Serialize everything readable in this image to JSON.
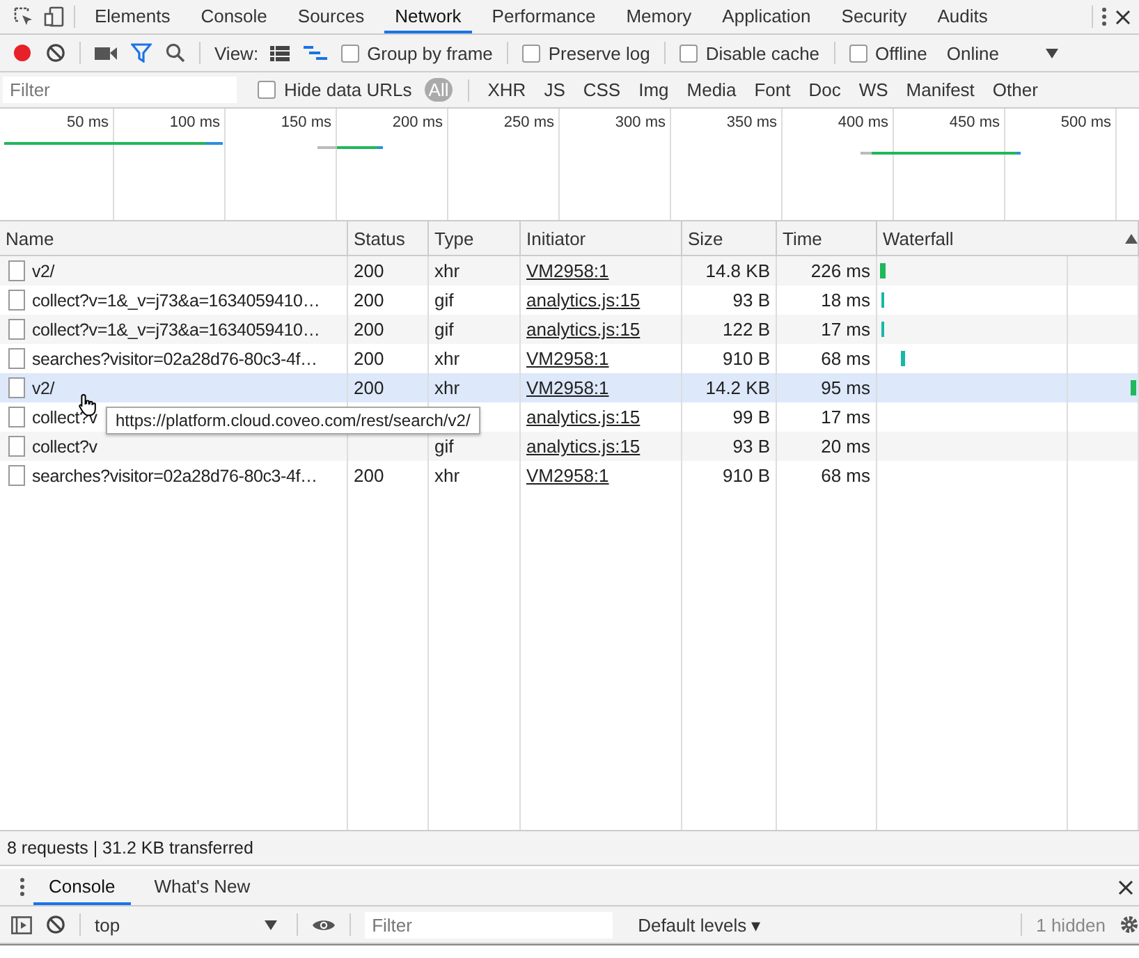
{
  "main_tabs": [
    {
      "label": "Elements",
      "selected": false
    },
    {
      "label": "Console",
      "selected": false
    },
    {
      "label": "Sources",
      "selected": false
    },
    {
      "label": "Network",
      "selected": true
    },
    {
      "label": "Performance",
      "selected": false
    },
    {
      "label": "Memory",
      "selected": false
    },
    {
      "label": "Application",
      "selected": false
    },
    {
      "label": "Security",
      "selected": false
    },
    {
      "label": "Audits",
      "selected": false
    }
  ],
  "toolbar": {
    "recording": true,
    "filter_active": true,
    "view_label": "View:",
    "options": [
      {
        "label": "Group by frame",
        "checked": false
      },
      {
        "label": "Preserve log",
        "checked": false
      },
      {
        "label": "Disable cache",
        "checked": false
      },
      {
        "label": "Offline",
        "checked": false
      }
    ],
    "throttling": "Online"
  },
  "filter_bar": {
    "placeholder": "Filter",
    "hide_data_urls": {
      "label": "Hide data URLs",
      "checked": false
    },
    "types": [
      {
        "label": "All",
        "selected": true
      },
      {
        "label": "XHR",
        "selected": false
      },
      {
        "label": "JS",
        "selected": false
      },
      {
        "label": "CSS",
        "selected": false
      },
      {
        "label": "Img",
        "selected": false
      },
      {
        "label": "Media",
        "selected": false
      },
      {
        "label": "Font",
        "selected": false
      },
      {
        "label": "Doc",
        "selected": false
      },
      {
        "label": "WS",
        "selected": false
      },
      {
        "label": "Manifest",
        "selected": false
      },
      {
        "label": "Other",
        "selected": false
      }
    ]
  },
  "overview": {
    "ticks": [
      "50 ms",
      "100 ms",
      "150 ms",
      "200 ms",
      "250 ms",
      "300 ms",
      "350 ms",
      "400 ms",
      "450 ms",
      "500 ms"
    ]
  },
  "table": {
    "columns": [
      "Name",
      "Status",
      "Type",
      "Initiator",
      "Size",
      "Time",
      "Waterfall"
    ],
    "rows": [
      {
        "name": "v2/",
        "status": "200",
        "type": "xhr",
        "initiator": "VM2958:1",
        "size": "14.8 KB",
        "time": "226 ms",
        "hovered": false
      },
      {
        "name": "collect?v=1&_v=j73&a=1634059410…",
        "status": "200",
        "type": "gif",
        "initiator": "analytics.js:15",
        "size": "93 B",
        "time": "18 ms",
        "hovered": false
      },
      {
        "name": "collect?v=1&_v=j73&a=1634059410…",
        "status": "200",
        "type": "gif",
        "initiator": "analytics.js:15",
        "size": "122 B",
        "time": "17 ms",
        "hovered": false
      },
      {
        "name": "searches?visitor=02a28d76-80c3-4f…",
        "status": "200",
        "type": "xhr",
        "initiator": "VM2958:1",
        "size": "910 B",
        "time": "68 ms",
        "hovered": false
      },
      {
        "name": "v2/",
        "status": "200",
        "type": "xhr",
        "initiator": "VM2958:1",
        "size": "14.2 KB",
        "time": "95 ms",
        "hovered": true
      },
      {
        "name": "collect?v",
        "initiator": "analytics.js:15",
        "size": "99 B",
        "time": "17 ms",
        "hovered": false
      },
      {
        "name": "collect?v",
        "type": "gif",
        "initiator": "analytics.js:15",
        "size": "93 B",
        "time": "20 ms",
        "hovered": false
      },
      {
        "name": "searches?visitor=02a28d76-80c3-4f…",
        "status": "200",
        "type": "xhr",
        "initiator": "VM2958:1",
        "size": "910 B",
        "time": "68 ms",
        "hovered": false
      }
    ],
    "tooltip": "https://platform.cloud.coveo.com/rest/search/v2/"
  },
  "status_bar": "8 requests | 31.2 KB transferred",
  "drawer": {
    "tabs": [
      {
        "label": "Console",
        "selected": true
      },
      {
        "label": "What's New",
        "selected": false
      }
    ],
    "context": "top",
    "filter_placeholder": "Filter",
    "levels": "Default levels ▾",
    "hidden": "1 hidden"
  }
}
